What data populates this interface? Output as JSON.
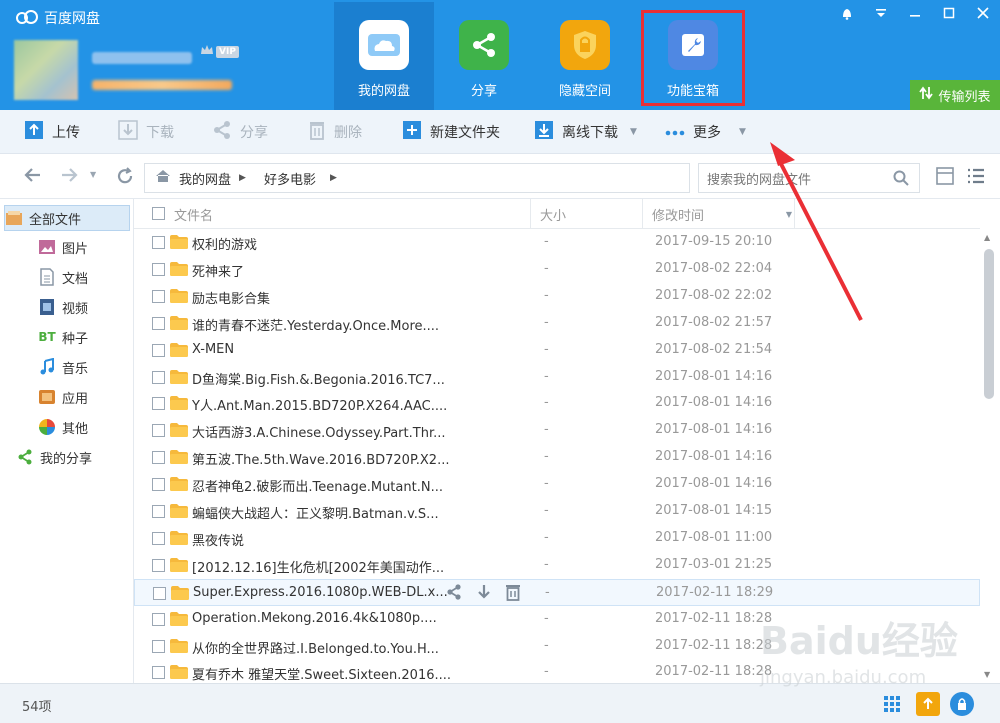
{
  "app": {
    "title": "百度网盘",
    "vip_label": "VIP"
  },
  "nav_tabs": [
    {
      "label": "我的网盘"
    },
    {
      "label": "分享"
    },
    {
      "label": "隐藏空间"
    },
    {
      "label": "功能宝箱"
    }
  ],
  "transfer_list_label": "传输列表",
  "toolbar": {
    "upload": "上传",
    "download": "下载",
    "share": "分享",
    "delete": "删除",
    "new_folder": "新建文件夹",
    "offline_download": "离线下载",
    "more": "更多"
  },
  "breadcrumb": [
    "我的网盘",
    "好多电影"
  ],
  "search": {
    "placeholder": "搜索我的网盘文件"
  },
  "sidebar": {
    "items": [
      {
        "label": "全部文件",
        "icon": "all-files-icon"
      },
      {
        "label": "图片",
        "icon": "picture-icon"
      },
      {
        "label": "文档",
        "icon": "document-icon"
      },
      {
        "label": "视频",
        "icon": "video-icon"
      },
      {
        "label": "种子",
        "icon": "bt-icon"
      },
      {
        "label": "音乐",
        "icon": "music-icon"
      },
      {
        "label": "应用",
        "icon": "app-icon"
      },
      {
        "label": "其他",
        "icon": "other-icon"
      },
      {
        "label": "我的分享",
        "icon": "share-icon"
      }
    ]
  },
  "columns": {
    "name": "文件名",
    "size": "大小",
    "modified": "修改时间"
  },
  "files": [
    {
      "name": "权利的游戏",
      "size": "-",
      "modified": "2017-09-15 20:10"
    },
    {
      "name": "死神来了",
      "size": "-",
      "modified": "2017-08-02 22:04"
    },
    {
      "name": "励志电影合集",
      "size": "-",
      "modified": "2017-08-02 22:02"
    },
    {
      "name": "谁的青春不迷茫.Yesterday.Once.More....",
      "size": "-",
      "modified": "2017-08-02 21:57"
    },
    {
      "name": "X-MEN",
      "size": "-",
      "modified": "2017-08-02 21:54"
    },
    {
      "name": "D鱼海棠.Big.Fish.&.Begonia.2016.TC7...",
      "size": "-",
      "modified": "2017-08-01 14:16"
    },
    {
      "name": "Y人.Ant.Man.2015.BD720P.X264.AAC....",
      "size": "-",
      "modified": "2017-08-01 14:16"
    },
    {
      "name": "大话西游3.A.Chinese.Odyssey.Part.Thr...",
      "size": "-",
      "modified": "2017-08-01 14:16"
    },
    {
      "name": "第五波.The.5th.Wave.2016.BD720P.X2...",
      "size": "-",
      "modified": "2017-08-01 14:16"
    },
    {
      "name": "忍者神龟2.破影而出.Teenage.Mutant.N...",
      "size": "-",
      "modified": "2017-08-01 14:16"
    },
    {
      "name": "蝙蝠侠大战超人：正义黎明.Batman.v.S...",
      "size": "-",
      "modified": "2017-08-01 14:15"
    },
    {
      "name": "黑夜传说",
      "size": "-",
      "modified": "2017-08-01 11:00"
    },
    {
      "name": "[2012.12.16]生化危机[2002年美国动作...",
      "size": "-",
      "modified": "2017-03-01 21:25"
    },
    {
      "name": "Super.Express.2016.1080p.WEB-DL.x...",
      "size": "-",
      "modified": "2017-02-11 18:29"
    },
    {
      "name": "Operation.Mekong.2016.4k&1080p....",
      "size": "-",
      "modified": "2017-02-11 18:28"
    },
    {
      "name": "从你的全世界路过.I.Belonged.to.You.H...",
      "size": "-",
      "modified": "2017-02-11 18:28"
    },
    {
      "name": "夏有乔木 雅望天堂.Sweet.Sixteen.2016....",
      "size": "-",
      "modified": "2017-02-11 18:28"
    }
  ],
  "status": {
    "item_count": "54项"
  },
  "watermark": {
    "logo": "Baidu经验",
    "url": "jingyan.baidu.com"
  },
  "colors": {
    "header": "#2393e6",
    "active_tab": "#1b7fd0",
    "highlight": "#ea2f35",
    "transfer_green": "#59b53a"
  }
}
